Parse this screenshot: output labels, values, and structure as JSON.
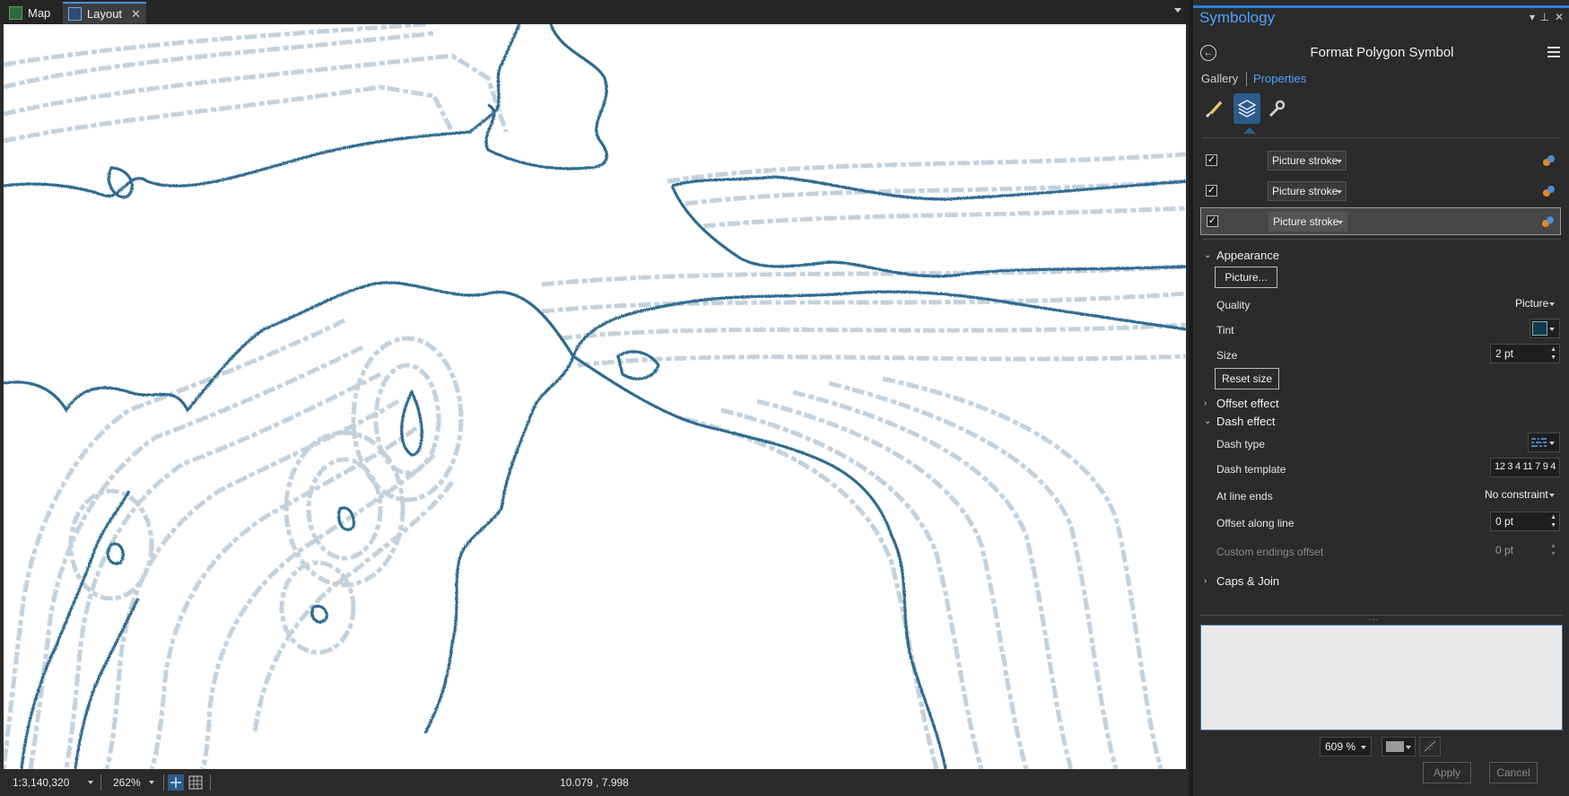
{
  "tabs": [
    {
      "label": "Map",
      "icon": "map-icon"
    },
    {
      "label": "Layout",
      "icon": "layout-icon",
      "close": "✕"
    }
  ],
  "statusbar": {
    "scale": "1:3,140,320",
    "zoom": "262%",
    "coordinates": "10.079 , 7.998"
  },
  "pane": {
    "title": "Symbology",
    "heading": "Format Polygon Symbol",
    "gallery_label": "Gallery",
    "properties_label": "Properties",
    "tools": [
      "brush-icon",
      "layers-icon",
      "wrench-icon"
    ],
    "layers": [
      {
        "checked": "✓",
        "type": "Picture stroke"
      },
      {
        "checked": "✓",
        "type": "Picture stroke"
      },
      {
        "checked": "✓",
        "type": "Picture stroke"
      }
    ],
    "appearance": {
      "header": "Appearance",
      "picture_button": "Picture...",
      "quality_label": "Quality",
      "quality_value": "Picture",
      "tint_label": "Tint",
      "tint_color": "#123a52",
      "size_label": "Size",
      "size_value": "2 pt",
      "reset_size": "Reset size"
    },
    "offset_effect": "Offset effect",
    "dash_effect": {
      "header": "Dash effect",
      "dash_type_label": "Dash type",
      "dash_template_label": "Dash template",
      "dash_template_value": "12 3 4 11 7 9 4",
      "at_line_ends_label": "At line ends",
      "at_line_ends_value": "No constraint",
      "offset_along_line_label": "Offset along line",
      "offset_along_line_value": "0 pt",
      "custom_endings_label": "Custom endings offset",
      "custom_endings_value": "0 pt"
    },
    "caps_join": "Caps & Join",
    "preview_zoom": "609 %",
    "apply": "Apply",
    "cancel": "Cancel"
  },
  "colors": {
    "accent": "#2f7fd6",
    "coast_stroke": "#2f6a8f",
    "contour_stroke": "#b8c8d6"
  }
}
